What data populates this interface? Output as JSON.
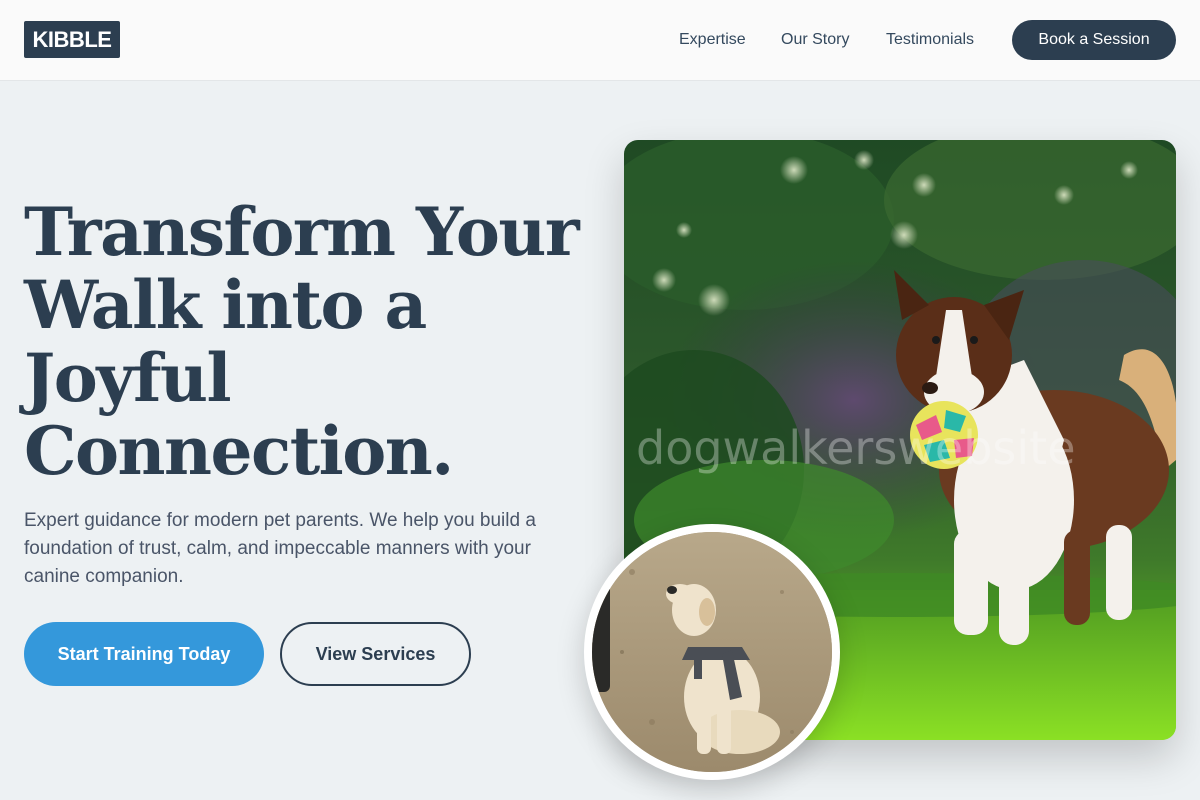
{
  "header": {
    "logo": "KIBBLE",
    "nav": [
      "Expertise",
      "Our Story",
      "Testimonials"
    ],
    "cta": "Book a Session"
  },
  "hero": {
    "headline_lines": [
      "Transform Your",
      "Walk into a",
      "Joyful",
      "Connection."
    ],
    "description": "Expert guidance for modern pet parents. We help you build a foundation of trust, calm, and impeccable manners with your canine companion.",
    "primary_button": "Start Training Today",
    "secondary_button": "View Services",
    "main_image": {
      "icon": "border-collie-with-ball-photo",
      "watermark": "dogwalkerswebsite"
    },
    "inset_image": {
      "icon": "labrador-in-harness-photo"
    }
  },
  "colors": {
    "background": "#edf1f3",
    "header_bg": "#fafafa",
    "brand_dark": "#2c3e50",
    "accent_blue": "#3498db",
    "body_text": "#4a5568"
  }
}
